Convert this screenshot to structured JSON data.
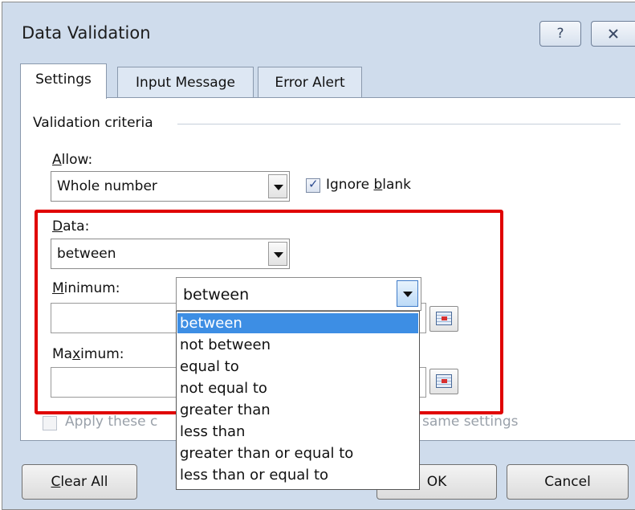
{
  "dialog": {
    "title": "Data Validation",
    "help_glyph": "?",
    "close_glyph": "X"
  },
  "tabs": [
    {
      "label": "Settings",
      "active": true
    },
    {
      "label": "Input Message",
      "active": false
    },
    {
      "label": "Error Alert",
      "active": false
    }
  ],
  "settings": {
    "group_label": "Validation criteria",
    "allow_label_ul": "A",
    "allow_label_rest": "llow:",
    "allow_value": "Whole number",
    "ignore_blank_pre": "Ignore ",
    "ignore_blank_ul": "b",
    "ignore_blank_post": "lank",
    "ignore_blank_checked": true,
    "data_label_ul": "D",
    "data_label_rest": "ata:",
    "data_value": "between",
    "minimum_label_ul": "M",
    "minimum_label_rest": "inimum:",
    "minimum_value": "",
    "maximum_label_pre": "Ma",
    "maximum_label_ul": "x",
    "maximum_label_post": "imum:",
    "maximum_value": "",
    "apply_text_left": "Apply these c",
    "apply_text_right": "same settings",
    "apply_checked": false
  },
  "dropdown": {
    "current": "between",
    "options": [
      "between",
      "not between",
      "equal to",
      "not equal to",
      "greater than",
      "less than",
      "greater than or equal to",
      "less than or equal to"
    ],
    "highlighted_index": 0
  },
  "buttons": {
    "clear_all_ul": "C",
    "clear_all_rest": "lear All",
    "ok": "OK",
    "cancel": "Cancel"
  },
  "colors": {
    "dialog_bg": "#cfdcec",
    "highlight": "#3d8ee4",
    "annotation_box": "#e00000"
  }
}
